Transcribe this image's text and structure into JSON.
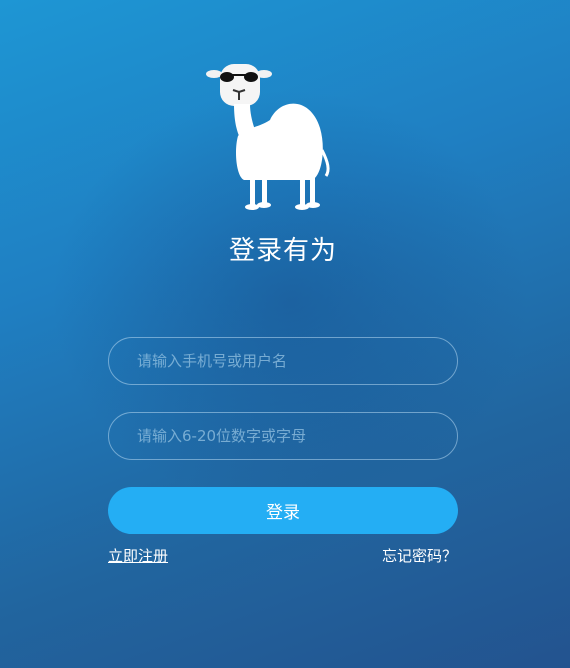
{
  "login": {
    "title": "登录有为",
    "username_placeholder": "请输入手机号或用户名",
    "password_placeholder": "请输入6-20位数字或字母",
    "submit_label": "登录",
    "register_link": "立即注册",
    "forgot_link": "忘记密码？"
  },
  "logo": {
    "icon": "camel-icon"
  },
  "colors": {
    "background_top": "#1e96d4",
    "background_bottom": "#23538f",
    "button": "#24aef4",
    "text": "#ffffff"
  }
}
